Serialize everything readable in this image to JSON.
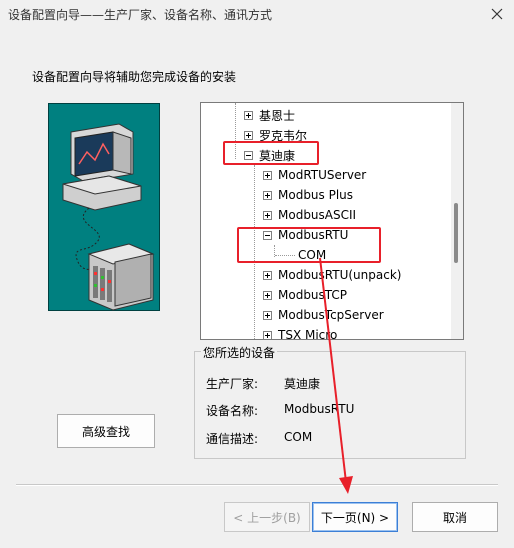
{
  "window": {
    "title": "设备配置向导——生产厂家、设备名称、通讯方式"
  },
  "intro_text": "设备配置向导将辅助您完成设备的安装",
  "tree": {
    "items": [
      {
        "label": "基恩士",
        "expander": "plus"
      },
      {
        "label": "罗克韦尔",
        "expander": "plus"
      },
      {
        "label": "莫迪康",
        "expander": "minus"
      },
      {
        "label": "ModRTUServer",
        "expander": "plus"
      },
      {
        "label": "Modbus Plus",
        "expander": "plus"
      },
      {
        "label": "ModbusASCII",
        "expander": "plus"
      },
      {
        "label": "ModbusRTU",
        "expander": "minus"
      },
      {
        "label": "COM",
        "expander": "none"
      },
      {
        "label": "ModbusRTU(unpack)",
        "expander": "plus"
      },
      {
        "label": "ModbusTCP",
        "expander": "plus"
      },
      {
        "label": "ModbusTcpServer",
        "expander": "plus"
      },
      {
        "label": "TSX Micro",
        "expander": "plus"
      }
    ]
  },
  "selected_device": {
    "group_title": "您所选的设备",
    "manufacturer_label": "生产厂家:",
    "manufacturer_value": "莫迪康",
    "device_name_label": "设备名称:",
    "device_name_value": "ModbusRTU",
    "comm_label": "通信描述:",
    "comm_value": "COM"
  },
  "buttons": {
    "advanced_search": "高级查找",
    "back": "< 上一步(B)",
    "next": "下一页(N) >",
    "cancel": "取消"
  },
  "colors": {
    "annotation_red": "#e8202a",
    "illustration_bg": "#008080",
    "window_bg": "#f0f0f0"
  }
}
